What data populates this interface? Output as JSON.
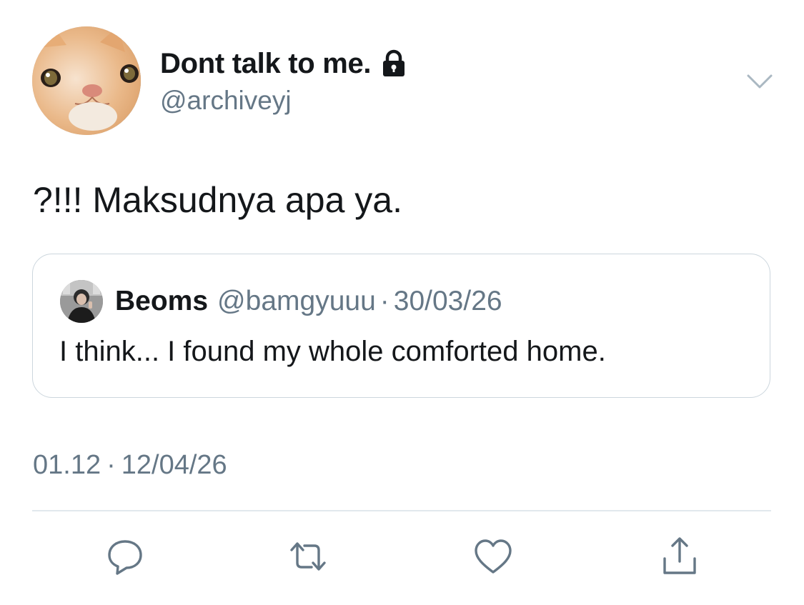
{
  "tweet": {
    "author": {
      "display_name": "Dont talk to me.",
      "handle": "@archiveyj",
      "protected_icon": "lock-icon",
      "avatar": "cat-avatar"
    },
    "menu_icon": "chevron-down-icon",
    "text": "?!!! Maksudnya apa ya.",
    "quoted_tweet": {
      "display_name": "Beoms",
      "handle": "@bamgyuuu",
      "separator": "·",
      "date": "30/03/26",
      "text": "I think... I found my whole comforted home.",
      "avatar": "user-avatar"
    },
    "timestamp": {
      "time": "01.12",
      "separator": "·",
      "date": "12/04/26"
    },
    "actions": [
      "reply-icon",
      "retweet-icon",
      "like-icon",
      "share-icon"
    ]
  },
  "colors": {
    "text_primary": "#14171a",
    "text_secondary": "#657786",
    "border": "#ccd6dd",
    "divider": "#e1e8ed",
    "icon": "#657786"
  }
}
